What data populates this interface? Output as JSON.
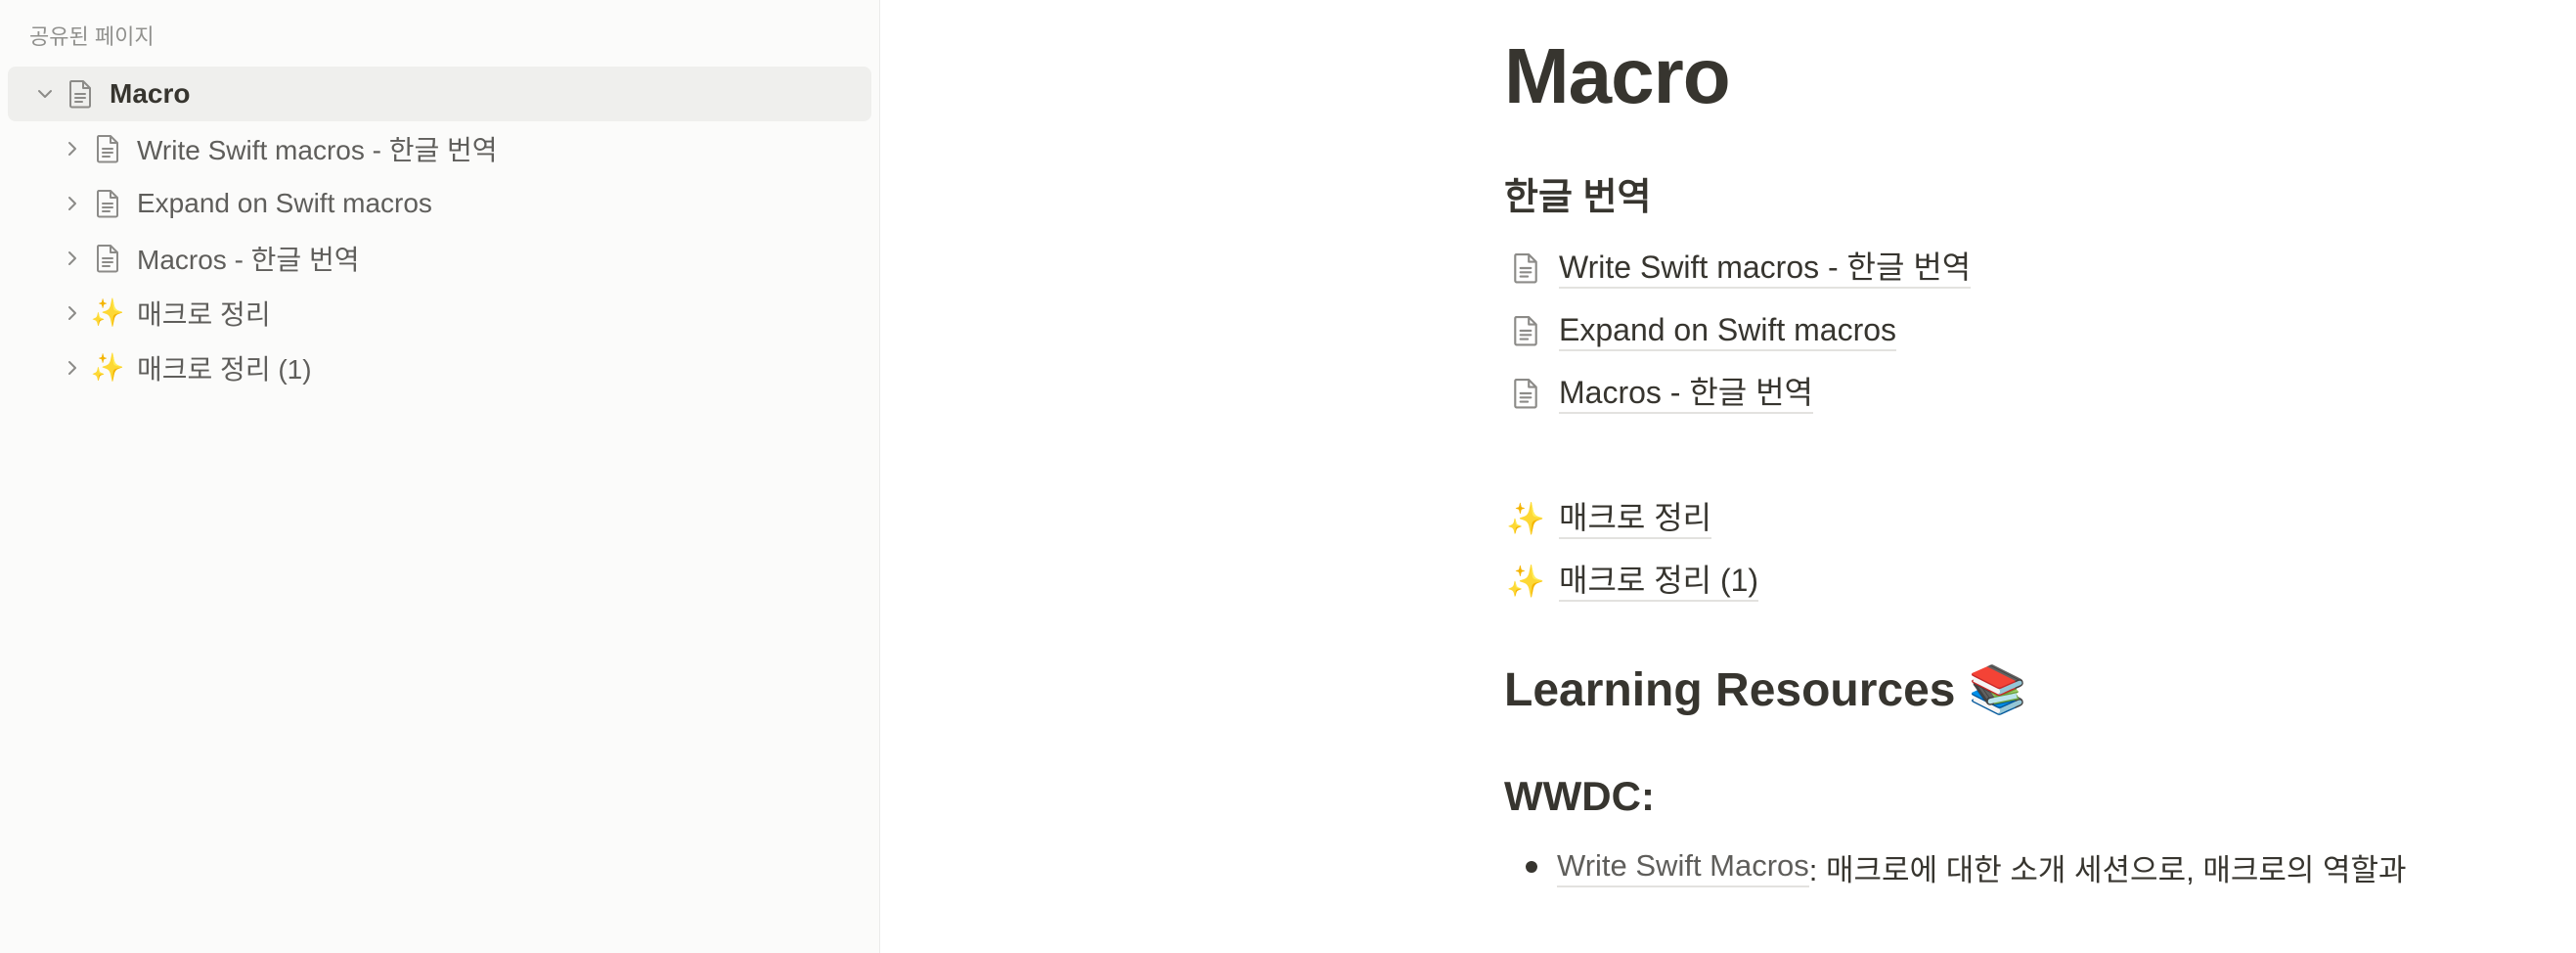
{
  "sidebar": {
    "section_title": "공유된 페이지",
    "root": {
      "label": "Macro",
      "icon": "page-icon",
      "expanded": true
    },
    "children": [
      {
        "label": "Write Swift macros - 한글 번역",
        "icon": "page-icon"
      },
      {
        "label": "Expand on Swift macros",
        "icon": "page-icon"
      },
      {
        "label": "Macros - 한글 번역",
        "icon": "page-icon"
      },
      {
        "label": "매크로 정리",
        "icon": "sparkles-icon",
        "emoji": "✨"
      },
      {
        "label": "매크로 정리 (1)",
        "icon": "sparkles-icon",
        "emoji": "✨"
      }
    ]
  },
  "page": {
    "title": "Macro",
    "translation_heading": "한글 번역",
    "translation_links": [
      {
        "label": "Write Swift macros - 한글 번역",
        "icon": "page-icon"
      },
      {
        "label": "Expand on Swift macros",
        "icon": "page-icon"
      },
      {
        "label": "Macros - 한글 번역",
        "icon": "page-icon"
      }
    ],
    "summary_links": [
      {
        "label": "매크로 정리",
        "icon": "sparkles-icon",
        "emoji": "✨"
      },
      {
        "label": "매크로 정리 (1)",
        "icon": "sparkles-icon",
        "emoji": "✨"
      }
    ],
    "resources_heading": "Learning Resources 📚",
    "wwdc_heading": "WWDC:",
    "wwdc_items": [
      {
        "link": "Write Swift Macros",
        "text": ": 매크로에 대한 소개 세션으로, 매크로의 역할과"
      }
    ]
  },
  "colors": {
    "sidebar_bg": "#fbfbfa",
    "active_row_bg": "#efefed",
    "text": "#37352f",
    "muted_text": "#91918e",
    "link_underline": "#e3e2df"
  }
}
